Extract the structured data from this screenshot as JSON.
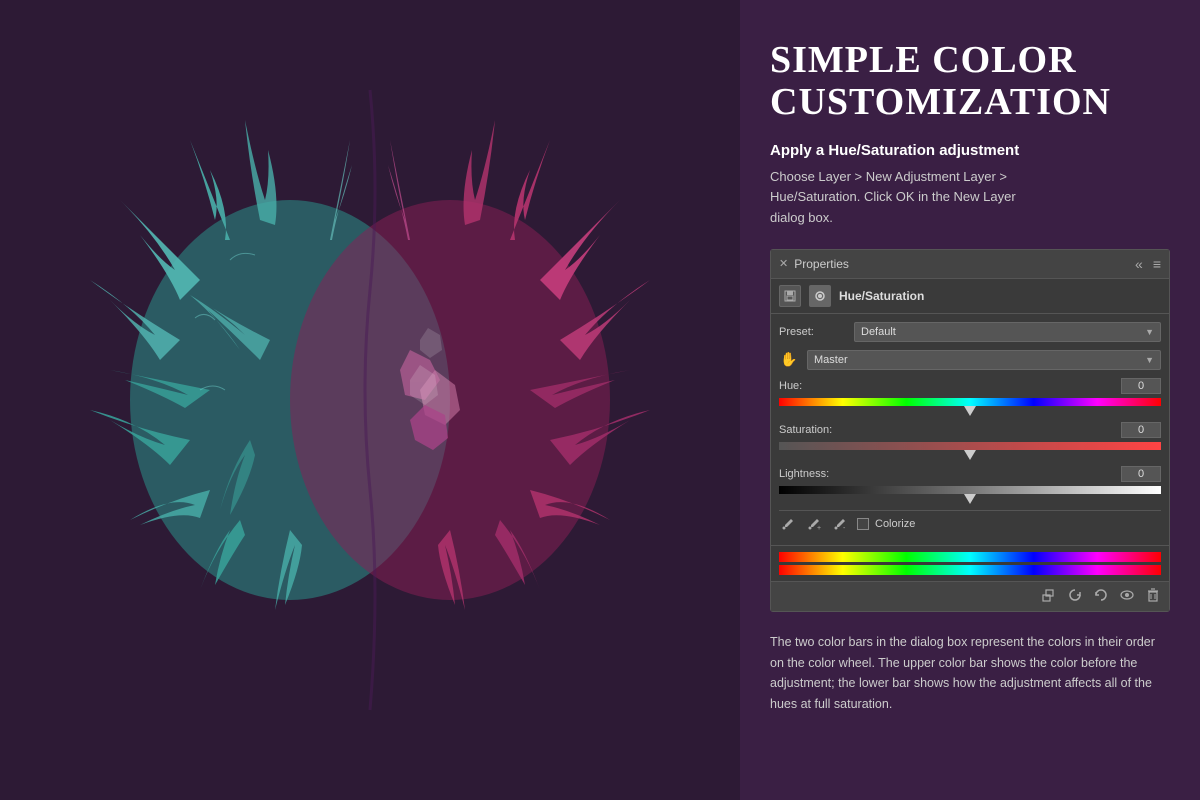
{
  "left_panel": {
    "background_color": "#2d1a35"
  },
  "right_panel": {
    "background_color": "#3a1f44",
    "title": "SIMPLE COLOR\nCUSTOMIZATION",
    "subtitle": "Apply a Hue/Saturation adjustment",
    "description": "Choose Layer > New Adjustment Layer >\nHue/Saturation. Click OK in the New Layer\ndialog box.",
    "breadcrumb_choose_layer": "Choose Layer",
    "breadcrumb_new_adjustment": "New Adjustment Layer"
  },
  "properties_panel": {
    "title": "Properties",
    "close_symbol": "✕",
    "menu_symbol": "≡",
    "collapse_symbol": "«",
    "panel_label": "Hue/Saturation",
    "preset_label": "Preset:",
    "preset_value": "Default",
    "channel_value": "Master",
    "hue_label": "Hue:",
    "hue_value": "0",
    "hue_thumb_position": "50",
    "saturation_label": "Saturation:",
    "saturation_value": "0",
    "saturation_thumb_position": "50",
    "lightness_label": "Lightness:",
    "lightness_value": "0",
    "lightness_thumb_position": "50",
    "colorize_label": "Colorize",
    "footer_icons": [
      "clip-icon",
      "reset-icon",
      "undo-icon",
      "visibility-icon",
      "delete-icon"
    ]
  },
  "bottom_text": "The two color bars in the dialog box represent the colors in their order on the color wheel. The upper color bar shows the color before the adjustment; the lower bar shows how the adjustment affects all of the hues at full saturation."
}
